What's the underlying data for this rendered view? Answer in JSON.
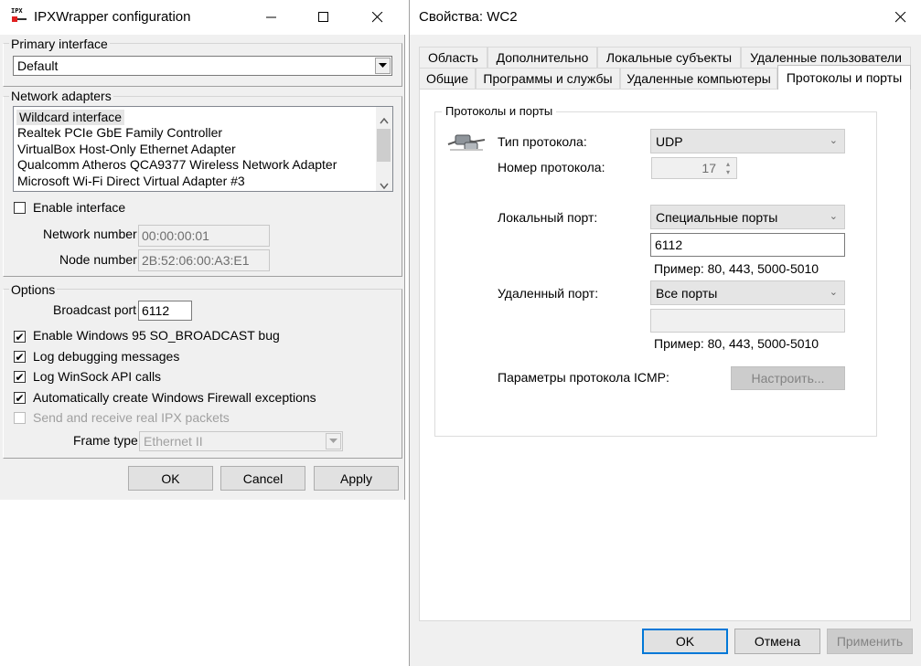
{
  "ipx": {
    "title": "IPXWrapper configuration",
    "app_icon_text": "IPX",
    "primary_interface": {
      "label": "Primary interface",
      "value": "Default"
    },
    "network_adapters": {
      "label": "Network adapters",
      "items": [
        "Wildcard interface",
        "Realtek PCIe GbE Family Controller",
        "VirtualBox Host-Only Ethernet Adapter",
        "Qualcomm Atheros QCA9377 Wireless Network Adapter",
        "Microsoft Wi-Fi Direct Virtual Adapter #3"
      ],
      "selected_index": 0
    },
    "enable_interface": {
      "label": "Enable interface",
      "checked": false
    },
    "network_number": {
      "label": "Network number",
      "value": "00:00:00:01"
    },
    "node_number": {
      "label": "Node number",
      "value": "2B:52:06:00:A3:E1"
    },
    "options": {
      "label": "Options",
      "broadcast_port": {
        "label": "Broadcast port",
        "value": "6112"
      },
      "so_broadcast_bug": {
        "label": "Enable Windows 95 SO_BROADCAST bug",
        "checked": true
      },
      "log_debug": {
        "label": "Log debugging messages",
        "checked": true
      },
      "log_winsock": {
        "label": "Log WinSock API calls",
        "checked": true
      },
      "firewall": {
        "label": "Automatically create Windows Firewall exceptions",
        "checked": true
      },
      "real_ipx": {
        "label": "Send and receive real IPX packets",
        "checked": false
      },
      "frame_type": {
        "label": "Frame type",
        "value": "Ethernet II"
      }
    },
    "buttons": {
      "ok": "OK",
      "cancel": "Cancel",
      "apply": "Apply"
    }
  },
  "props": {
    "title": "Свойства: WC2",
    "tabs_row1": [
      "Область",
      "Дополнительно",
      "Локальные субъекты",
      "Удаленные пользователи"
    ],
    "tabs_row2": [
      "Общие",
      "Программы и службы",
      "Удаленные компьютеры",
      "Протоколы и порты"
    ],
    "active_tab": "Протоколы и порты",
    "group_label": "Протоколы и порты",
    "protocol_type": {
      "label": "Тип протокола:",
      "value": "UDP"
    },
    "protocol_number": {
      "label": "Номер протокола:",
      "value": "17"
    },
    "local_port": {
      "label": "Локальный порт:",
      "value": "Специальные порты",
      "input": "6112",
      "example": "Пример: 80, 443, 5000-5010"
    },
    "remote_port": {
      "label": "Удаленный порт:",
      "value": "Все порты",
      "input": "",
      "example": "Пример: 80, 443, 5000-5010"
    },
    "icmp": {
      "label": "Параметры протокола ICMP:",
      "button": "Настроить..."
    },
    "buttons": {
      "ok": "OK",
      "cancel": "Отмена",
      "apply": "Применить"
    }
  },
  "colors": {
    "accent": "#0078d7",
    "window_bg": "#f0f0f0",
    "disabled_text": "#a0a0a0"
  }
}
